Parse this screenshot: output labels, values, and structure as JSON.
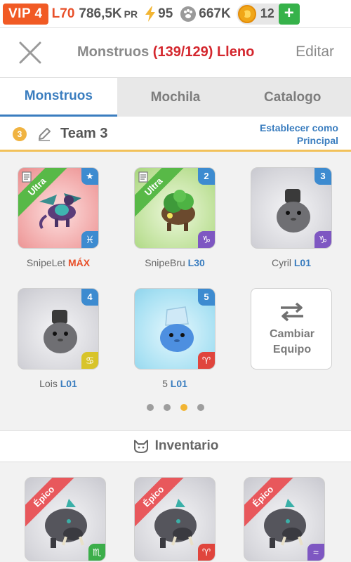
{
  "status": {
    "vip": "VIP 4",
    "level": "L70",
    "power_value": "786,5K",
    "power_unit": "PR",
    "energy": "95",
    "paw_currency": "667K",
    "gold_currency": "12",
    "add_label": "+"
  },
  "header": {
    "title_prefix": "Monstruos",
    "title_count": "(139/129) Lleno",
    "edit_label": "Editar"
  },
  "tabs": [
    {
      "label": "Monstruos",
      "active": true
    },
    {
      "label": "Mochila",
      "active": false
    },
    {
      "label": "Catalogo",
      "active": false
    }
  ],
  "team": {
    "badge": "3",
    "name": "Team 3",
    "set_main_line1": "Establecer como",
    "set_main_line2": "Principal"
  },
  "team_slots": [
    {
      "name": "SnipeLet",
      "level": "MÁX",
      "ribbon": "Ultra",
      "slot": "★",
      "zodiac": "♓",
      "bg": "red"
    },
    {
      "name": "SnipeBru",
      "level": "L30",
      "ribbon": "Ultra",
      "slot": "2",
      "zodiac": "♑",
      "bg": "green"
    },
    {
      "name": "Cyril",
      "level": "L01",
      "ribbon": "",
      "slot": "3",
      "zodiac": "♑",
      "bg": "gray"
    },
    {
      "name": "Lois",
      "level": "L01",
      "ribbon": "",
      "slot": "4",
      "zodiac": "♋",
      "bg": "gray"
    },
    {
      "name": "5",
      "level": "L01",
      "ribbon": "",
      "slot": "5",
      "zodiac": "♈",
      "bg": "blue"
    }
  ],
  "swap_button": {
    "line1": "Cambiar",
    "line2": "Equipo"
  },
  "pagination": {
    "total": 4,
    "active_index": 2
  },
  "inventory": {
    "title": "Inventario",
    "items": [
      {
        "ribbon": "Épico",
        "zodiac": "♏"
      },
      {
        "ribbon": "Épico",
        "zodiac": "♈"
      },
      {
        "ribbon": "Épico",
        "zodiac": "≈"
      }
    ]
  }
}
